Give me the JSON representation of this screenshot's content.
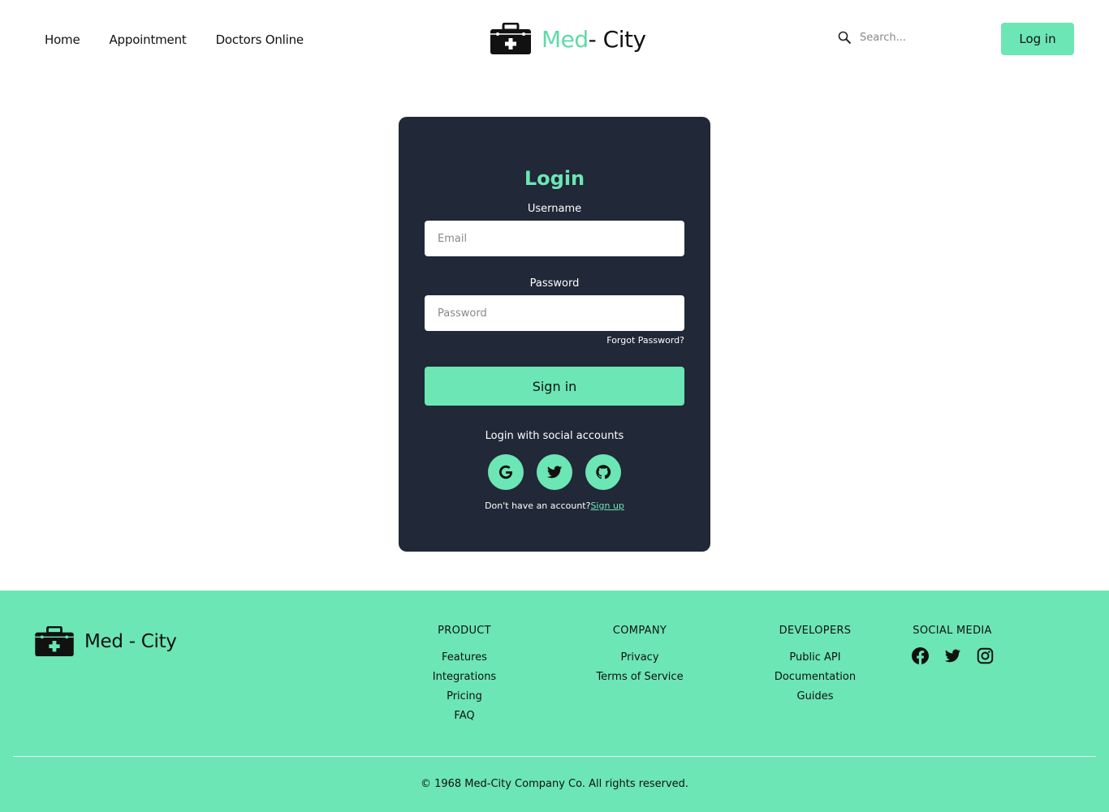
{
  "header": {
    "nav": [
      "Home",
      "Appointment",
      "Doctors Online"
    ],
    "brand_med": "Med",
    "brand_city": "- City",
    "search_placeholder": "Search...",
    "login_label": "Log in"
  },
  "login": {
    "title": "Login",
    "username_label": "Username",
    "username_placeholder": "Email",
    "password_label": "Password",
    "password_placeholder": "Password",
    "forgot": "Forgot Password?",
    "signin_label": "Sign in",
    "social_title": "Login with social accounts",
    "social_icons": [
      "google-icon",
      "twitter-icon",
      "github-icon"
    ],
    "no_account": "Don't have an account?",
    "signup": "Sign up"
  },
  "footer": {
    "brand": "Med - City",
    "columns": [
      {
        "title": "PRODUCT",
        "links": [
          "Features",
          "Integrations",
          "Pricing",
          "FAQ"
        ]
      },
      {
        "title": "COMPANY",
        "links": [
          "Privacy",
          "Terms of Service"
        ]
      },
      {
        "title": "DEVELOPERS",
        "links": [
          "Public API",
          "Documentation",
          "Guides"
        ]
      }
    ],
    "social_title": "SOCIAL MEDIA",
    "social_icons": [
      "facebook-icon",
      "twitter-icon",
      "instagram-icon"
    ],
    "copyright": "© 1968 Med-City Company Co. All rights reserved."
  },
  "colors": {
    "accent": "#6ce6b4",
    "card_bg": "#212837",
    "brand_green": "#5fdba8"
  }
}
